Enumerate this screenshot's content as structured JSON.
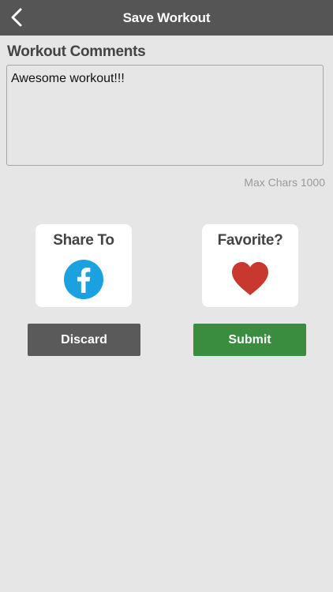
{
  "header": {
    "title": "Save Workout",
    "back_icon": "chevron-left-icon"
  },
  "comments": {
    "label": "Workout Comments",
    "value": "Awesome workout!!!",
    "max_chars_text": "Max Chars 1000"
  },
  "share": {
    "title": "Share To",
    "icon": "facebook-icon",
    "icon_color": "#1aa1e0"
  },
  "favorite": {
    "title": "Favorite?",
    "icon": "heart-icon",
    "icon_color": "#c8382e"
  },
  "actions": {
    "discard_label": "Discard",
    "submit_label": "Submit",
    "discard_color": "#5a5a5a",
    "submit_color": "#3a8d3f"
  }
}
